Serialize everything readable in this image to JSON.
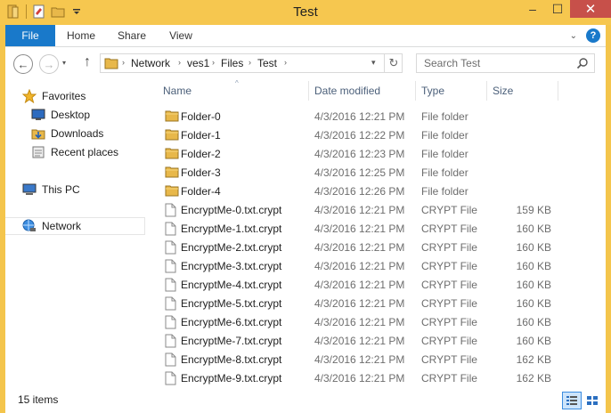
{
  "window": {
    "title": "Test",
    "minimize": "–",
    "maximize": "☐",
    "close": "✕"
  },
  "ribbon": {
    "tabs": [
      "File",
      "Home",
      "Share",
      "View"
    ],
    "expand_label": "⌄",
    "help_label": "?"
  },
  "navigation": {
    "back_glyph": "←",
    "forward_glyph": "→",
    "recent_glyph": "▾",
    "up_glyph": "↑",
    "breadcrumb": [
      "Network",
      "ves1",
      "Files",
      "Test"
    ],
    "separator": "›",
    "dropdown_glyph": "▾",
    "refresh_glyph": "↻",
    "search_placeholder": "Search Test"
  },
  "sidebar": {
    "items": [
      {
        "label": "Favorites",
        "icon": "star-icon"
      },
      {
        "label": "Desktop",
        "icon": "desktop-icon"
      },
      {
        "label": "Downloads",
        "icon": "downloads-icon"
      },
      {
        "label": "Recent places",
        "icon": "recent-places-icon"
      },
      {
        "label": "This PC",
        "icon": "computer-icon"
      },
      {
        "label": "Network",
        "icon": "network-icon"
      }
    ]
  },
  "columns": {
    "name": "Name",
    "date": "Date modified",
    "type": "Type",
    "size": "Size",
    "sort_glyph": "^"
  },
  "files": [
    {
      "name": "Folder-0",
      "date": "4/3/2016 12:21 PM",
      "type": "File folder",
      "size": "",
      "kind": "folder"
    },
    {
      "name": "Folder-1",
      "date": "4/3/2016 12:22 PM",
      "type": "File folder",
      "size": "",
      "kind": "folder"
    },
    {
      "name": "Folder-2",
      "date": "4/3/2016 12:23 PM",
      "type": "File folder",
      "size": "",
      "kind": "folder"
    },
    {
      "name": "Folder-3",
      "date": "4/3/2016 12:25 PM",
      "type": "File folder",
      "size": "",
      "kind": "folder"
    },
    {
      "name": "Folder-4",
      "date": "4/3/2016 12:26 PM",
      "type": "File folder",
      "size": "",
      "kind": "folder"
    },
    {
      "name": "EncryptMe-0.txt.crypt",
      "date": "4/3/2016 12:21 PM",
      "type": "CRYPT File",
      "size": "159 KB",
      "kind": "file"
    },
    {
      "name": "EncryptMe-1.txt.crypt",
      "date": "4/3/2016 12:21 PM",
      "type": "CRYPT File",
      "size": "160 KB",
      "kind": "file"
    },
    {
      "name": "EncryptMe-2.txt.crypt",
      "date": "4/3/2016 12:21 PM",
      "type": "CRYPT File",
      "size": "160 KB",
      "kind": "file"
    },
    {
      "name": "EncryptMe-3.txt.crypt",
      "date": "4/3/2016 12:21 PM",
      "type": "CRYPT File",
      "size": "160 KB",
      "kind": "file"
    },
    {
      "name": "EncryptMe-4.txt.crypt",
      "date": "4/3/2016 12:21 PM",
      "type": "CRYPT File",
      "size": "160 KB",
      "kind": "file"
    },
    {
      "name": "EncryptMe-5.txt.crypt",
      "date": "4/3/2016 12:21 PM",
      "type": "CRYPT File",
      "size": "160 KB",
      "kind": "file"
    },
    {
      "name": "EncryptMe-6.txt.crypt",
      "date": "4/3/2016 12:21 PM",
      "type": "CRYPT File",
      "size": "160 KB",
      "kind": "file"
    },
    {
      "name": "EncryptMe-7.txt.crypt",
      "date": "4/3/2016 12:21 PM",
      "type": "CRYPT File",
      "size": "160 KB",
      "kind": "file"
    },
    {
      "name": "EncryptMe-8.txt.crypt",
      "date": "4/3/2016 12:21 PM",
      "type": "CRYPT File",
      "size": "162 KB",
      "kind": "file"
    },
    {
      "name": "EncryptMe-9.txt.crypt",
      "date": "4/3/2016 12:21 PM",
      "type": "CRYPT File",
      "size": "162 KB",
      "kind": "file"
    }
  ],
  "status": {
    "item_count": "15 items"
  },
  "colors": {
    "frame": "#f4c54c",
    "accent": "#1979ca",
    "close": "#c7504a",
    "folder": "#e8b84a"
  }
}
